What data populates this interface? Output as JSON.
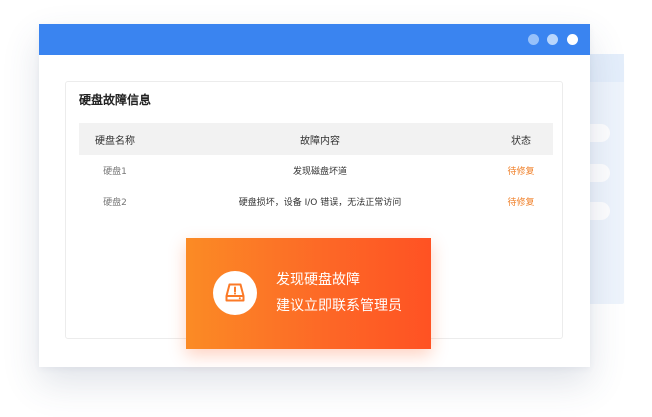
{
  "window": {
    "accent_color": "#3a84f0",
    "controls": [
      "dot",
      "dot",
      "dot"
    ]
  },
  "card": {
    "title": "硬盘故障信息",
    "table": {
      "headers": [
        "硬盘名称",
        "故障内容",
        "状态"
      ],
      "rows": [
        {
          "name": "硬盘1",
          "fault": "发现磁盘坏道",
          "status": "待修复"
        },
        {
          "name": "硬盘2",
          "fault": "硬盘损坏，设备 I/O 错误，无法正常访问",
          "status": "待修复"
        }
      ]
    },
    "status_color": "#f0802a"
  },
  "alert": {
    "icon": "hard-drive-warning-icon",
    "line1": "发现硬盘故障",
    "line2": "建议立即联系管理员",
    "gradient_start": "#fb8b25",
    "gradient_end": "#ff5223"
  }
}
